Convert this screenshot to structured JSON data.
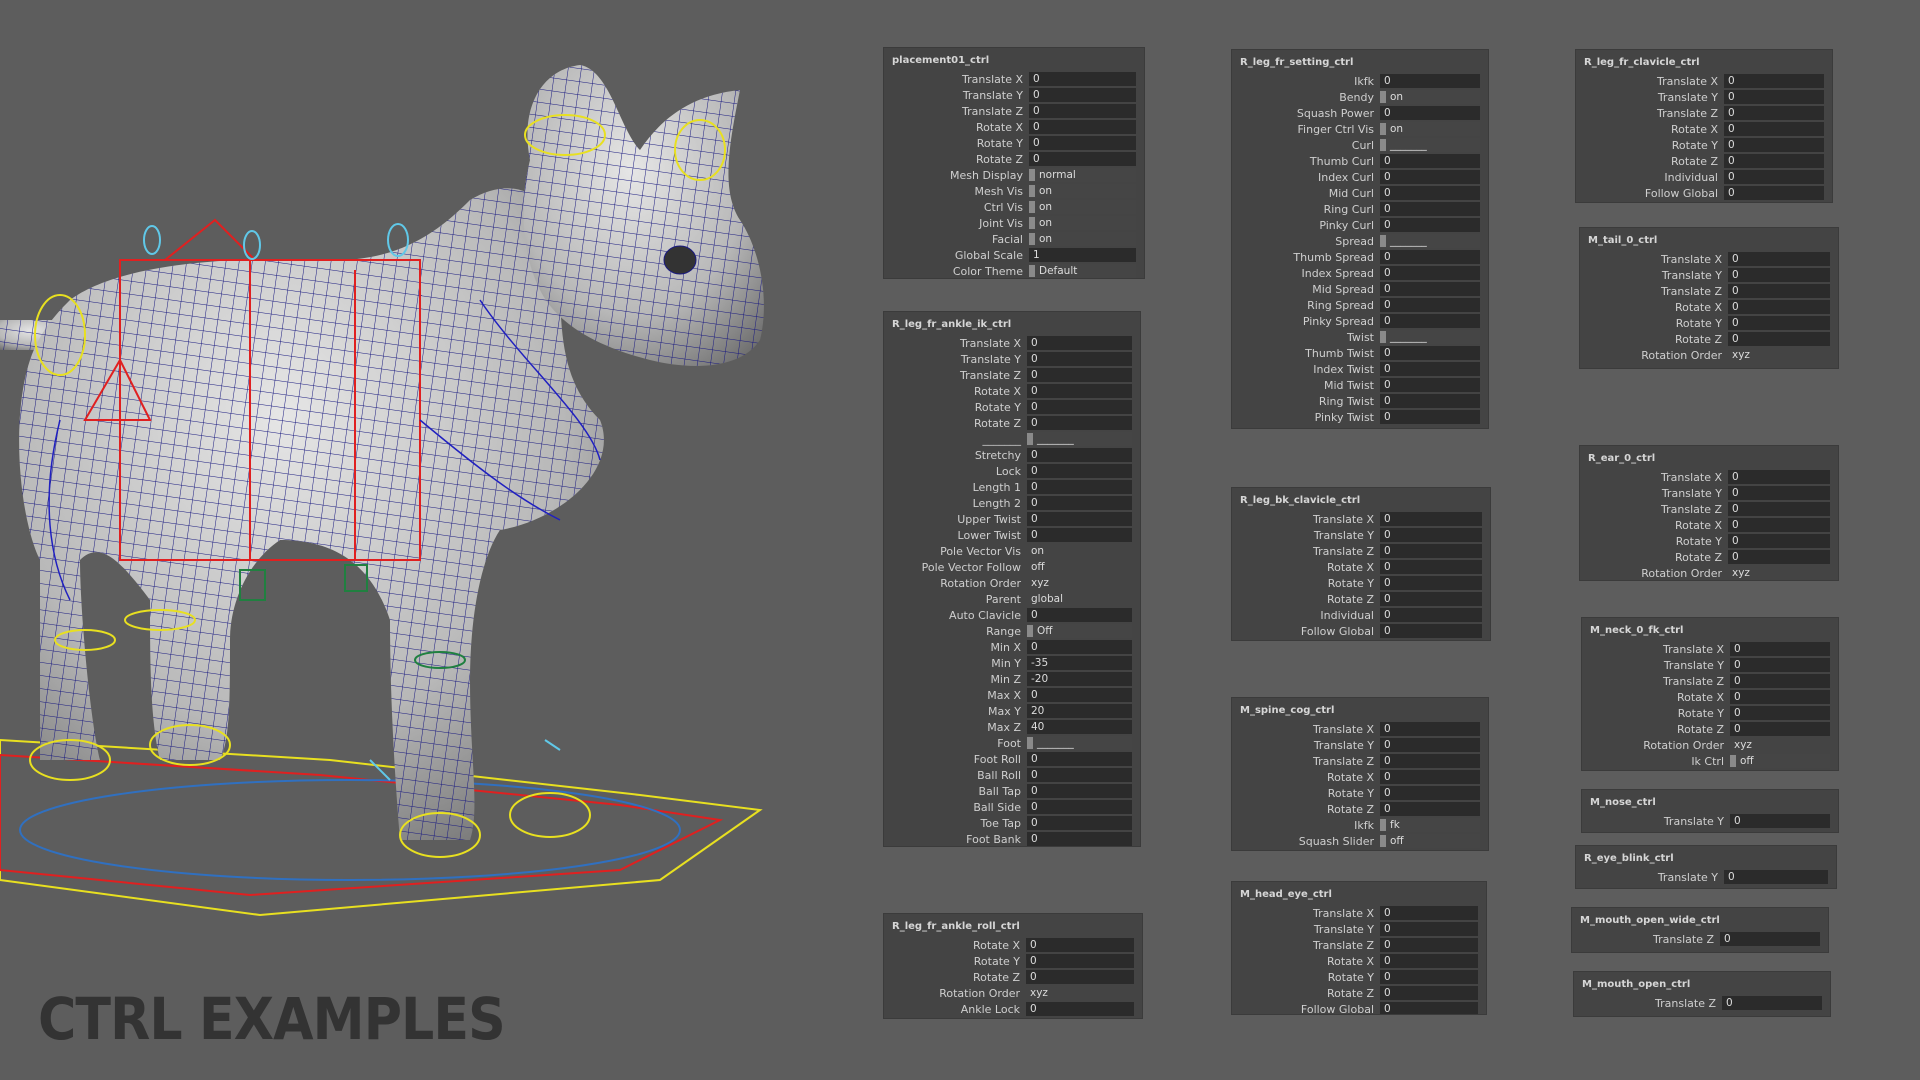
{
  "title": "CTRL EXAMPLES",
  "colors": {
    "background": "#5d5d5d",
    "panel": "#444444",
    "field": "#2b2b2b",
    "wire": "#1a1a80",
    "ctrl_red": "#e02020",
    "ctrl_yellow": "#e8e020",
    "ctrl_cyan": "#60c8e8",
    "ctrl_green": "#208040"
  },
  "panels": [
    {
      "title": "placement01_ctrl",
      "rows": [
        {
          "label": "Translate X",
          "value": "0"
        },
        {
          "label": "Translate Y",
          "value": "0"
        },
        {
          "label": "Translate Z",
          "value": "0"
        },
        {
          "label": "Rotate X",
          "value": "0"
        },
        {
          "label": "Rotate Y",
          "value": "0"
        },
        {
          "label": "Rotate Z",
          "value": "0"
        },
        {
          "label": "Mesh Display",
          "value": "normal",
          "kind": "enum"
        },
        {
          "label": "Mesh Vis",
          "value": "on",
          "kind": "enum"
        },
        {
          "label": "Ctrl Vis",
          "value": "on",
          "kind": "enum"
        },
        {
          "label": "Joint Vis",
          "value": "on",
          "kind": "enum"
        },
        {
          "label": "Facial",
          "value": "on",
          "kind": "enum"
        },
        {
          "label": "Global Scale",
          "value": "1"
        },
        {
          "label": "Color Theme",
          "value": "Default",
          "kind": "enum"
        }
      ]
    },
    {
      "title": "R_leg_fr_ankle_ik_ctrl",
      "rows": [
        {
          "label": "Translate X",
          "value": "0"
        },
        {
          "label": "Translate Y",
          "value": "0"
        },
        {
          "label": "Translate Z",
          "value": "0"
        },
        {
          "label": "Rotate X",
          "value": "0"
        },
        {
          "label": "Rotate Y",
          "value": "0"
        },
        {
          "label": "Rotate Z",
          "value": "0"
        },
        {
          "label": "_______",
          "value": "_______",
          "kind": "enum"
        },
        {
          "label": "Stretchy",
          "value": "0"
        },
        {
          "label": "Lock",
          "value": "0"
        },
        {
          "label": "Length 1",
          "value": "0"
        },
        {
          "label": "Length 2",
          "value": "0"
        },
        {
          "label": "Upper Twist",
          "value": "0"
        },
        {
          "label": "Lower Twist",
          "value": "0"
        },
        {
          "label": "Pole Vector Vis",
          "value": "on",
          "kind": "plain"
        },
        {
          "label": "Pole Vector Follow",
          "value": "off",
          "kind": "plain"
        },
        {
          "label": "Rotation Order",
          "value": "xyz",
          "kind": "plain"
        },
        {
          "label": "Parent",
          "value": "global",
          "kind": "plain"
        },
        {
          "label": "Auto Clavicle",
          "value": "0"
        },
        {
          "label": "Range",
          "value": "Off",
          "kind": "enum"
        },
        {
          "label": "Min X",
          "value": "0"
        },
        {
          "label": "Min Y",
          "value": "-35"
        },
        {
          "label": "Min Z",
          "value": "-20"
        },
        {
          "label": "Max X",
          "value": "0"
        },
        {
          "label": "Max Y",
          "value": "20"
        },
        {
          "label": "Max Z",
          "value": "40"
        },
        {
          "label": "Foot",
          "value": "_______",
          "kind": "enum"
        },
        {
          "label": "Foot Roll",
          "value": "0"
        },
        {
          "label": "Ball Roll",
          "value": "0"
        },
        {
          "label": "Ball Tap",
          "value": "0"
        },
        {
          "label": "Ball Side",
          "value": "0"
        },
        {
          "label": "Toe Tap",
          "value": "0"
        },
        {
          "label": "Foot Bank",
          "value": "0"
        }
      ]
    },
    {
      "title": "R_leg_fr_ankle_roll_ctrl",
      "rows": [
        {
          "label": "Rotate X",
          "value": "0"
        },
        {
          "label": "Rotate Y",
          "value": "0"
        },
        {
          "label": "Rotate Z",
          "value": "0"
        },
        {
          "label": "Rotation Order",
          "value": "xyz",
          "kind": "plain"
        },
        {
          "label": "Ankle Lock",
          "value": "0"
        }
      ]
    },
    {
      "title": "R_leg_fr_setting_ctrl",
      "rows": [
        {
          "label": "Ikfk",
          "value": "0"
        },
        {
          "label": "Bendy",
          "value": "on",
          "kind": "enum"
        },
        {
          "label": "Squash Power",
          "value": "0"
        },
        {
          "label": "Finger Ctrl Vis",
          "value": "on",
          "kind": "enum"
        },
        {
          "label": "Curl",
          "value": "_______",
          "kind": "enum"
        },
        {
          "label": "Thumb Curl",
          "value": "0"
        },
        {
          "label": "Index Curl",
          "value": "0"
        },
        {
          "label": "Mid Curl",
          "value": "0"
        },
        {
          "label": "Ring Curl",
          "value": "0"
        },
        {
          "label": "Pinky Curl",
          "value": "0"
        },
        {
          "label": "Spread",
          "value": "_______",
          "kind": "enum"
        },
        {
          "label": "Thumb Spread",
          "value": "0"
        },
        {
          "label": "Index Spread",
          "value": "0"
        },
        {
          "label": "Mid Spread",
          "value": "0"
        },
        {
          "label": "Ring Spread",
          "value": "0"
        },
        {
          "label": "Pinky Spread",
          "value": "0"
        },
        {
          "label": "Twist",
          "value": "_______",
          "kind": "enum"
        },
        {
          "label": "Thumb Twist",
          "value": "0"
        },
        {
          "label": "Index Twist",
          "value": "0"
        },
        {
          "label": "Mid Twist",
          "value": "0"
        },
        {
          "label": "Ring Twist",
          "value": "0"
        },
        {
          "label": "Pinky Twist",
          "value": "0"
        }
      ]
    },
    {
      "title": "R_leg_bk_clavicle_ctrl",
      "rows": [
        {
          "label": "Translate X",
          "value": "0"
        },
        {
          "label": "Translate Y",
          "value": "0"
        },
        {
          "label": "Translate Z",
          "value": "0"
        },
        {
          "label": "Rotate X",
          "value": "0"
        },
        {
          "label": "Rotate Y",
          "value": "0"
        },
        {
          "label": "Rotate Z",
          "value": "0"
        },
        {
          "label": "Individual",
          "value": "0"
        },
        {
          "label": "Follow Global",
          "value": "0"
        }
      ]
    },
    {
      "title": "M_spine_cog_ctrl",
      "rows": [
        {
          "label": "Translate X",
          "value": "0"
        },
        {
          "label": "Translate Y",
          "value": "0"
        },
        {
          "label": "Translate Z",
          "value": "0"
        },
        {
          "label": "Rotate X",
          "value": "0"
        },
        {
          "label": "Rotate Y",
          "value": "0"
        },
        {
          "label": "Rotate Z",
          "value": "0"
        },
        {
          "label": "Ikfk",
          "value": "fk",
          "kind": "enum"
        },
        {
          "label": "Squash Slider",
          "value": "off",
          "kind": "enum"
        }
      ]
    },
    {
      "title": "M_head_eye_ctrl",
      "rows": [
        {
          "label": "Translate X",
          "value": "0"
        },
        {
          "label": "Translate Y",
          "value": "0"
        },
        {
          "label": "Translate Z",
          "value": "0"
        },
        {
          "label": "Rotate X",
          "value": "0"
        },
        {
          "label": "Rotate Y",
          "value": "0"
        },
        {
          "label": "Rotate Z",
          "value": "0"
        },
        {
          "label": "Follow Global",
          "value": "0"
        }
      ]
    },
    {
      "title": "R_leg_fr_clavicle_ctrl",
      "rows": [
        {
          "label": "Translate X",
          "value": "0"
        },
        {
          "label": "Translate Y",
          "value": "0"
        },
        {
          "label": "Translate Z",
          "value": "0"
        },
        {
          "label": "Rotate X",
          "value": "0"
        },
        {
          "label": "Rotate Y",
          "value": "0"
        },
        {
          "label": "Rotate Z",
          "value": "0"
        },
        {
          "label": "Individual",
          "value": "0"
        },
        {
          "label": "Follow Global",
          "value": "0"
        }
      ]
    },
    {
      "title": "M_tail_0_ctrl",
      "rows": [
        {
          "label": "Translate X",
          "value": "0"
        },
        {
          "label": "Translate Y",
          "value": "0"
        },
        {
          "label": "Translate Z",
          "value": "0"
        },
        {
          "label": "Rotate X",
          "value": "0"
        },
        {
          "label": "Rotate Y",
          "value": "0"
        },
        {
          "label": "Rotate Z",
          "value": "0"
        },
        {
          "label": "Rotation Order",
          "value": "xyz",
          "kind": "plain"
        }
      ]
    },
    {
      "title": "R_ear_0_ctrl",
      "rows": [
        {
          "label": "Translate X",
          "value": "0"
        },
        {
          "label": "Translate Y",
          "value": "0"
        },
        {
          "label": "Translate Z",
          "value": "0"
        },
        {
          "label": "Rotate X",
          "value": "0"
        },
        {
          "label": "Rotate Y",
          "value": "0"
        },
        {
          "label": "Rotate Z",
          "value": "0"
        },
        {
          "label": "Rotation Order",
          "value": "xyz",
          "kind": "plain"
        }
      ]
    },
    {
      "title": "M_neck_0_fk_ctrl",
      "rows": [
        {
          "label": "Translate X",
          "value": "0"
        },
        {
          "label": "Translate Y",
          "value": "0"
        },
        {
          "label": "Translate Z",
          "value": "0"
        },
        {
          "label": "Rotate X",
          "value": "0"
        },
        {
          "label": "Rotate Y",
          "value": "0"
        },
        {
          "label": "Rotate Z",
          "value": "0"
        },
        {
          "label": "Rotation Order",
          "value": "xyz",
          "kind": "plain"
        },
        {
          "label": "Ik Ctrl",
          "value": "off",
          "kind": "enum"
        }
      ]
    },
    {
      "title": "M_nose_ctrl",
      "rows": [
        {
          "label": "Translate Y",
          "value": "0"
        }
      ]
    },
    {
      "title": "R_eye_blink_ctrl",
      "rows": [
        {
          "label": "Translate Y",
          "value": "0"
        }
      ]
    },
    {
      "title": "M_mouth_open_wide_ctrl",
      "rows": [
        {
          "label": "Translate Z",
          "value": "0"
        }
      ]
    },
    {
      "title": "M_mouth_open_ctrl",
      "rows": [
        {
          "label": "Translate Z",
          "value": "0"
        }
      ]
    }
  ]
}
